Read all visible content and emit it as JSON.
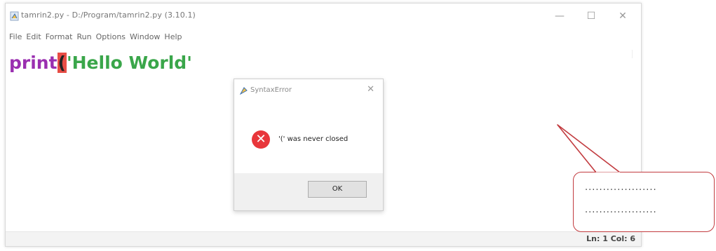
{
  "window": {
    "title": "tamrin2.py - D:/Program/tamrin2.py (3.10.1)",
    "minimize_glyph": "—",
    "maximize_glyph": "☐",
    "close_glyph": "✕"
  },
  "menu": [
    "File",
    "Edit",
    "Format",
    "Run",
    "Options",
    "Window",
    "Help"
  ],
  "editor": {
    "keyword": "print",
    "paren": "(",
    "string": "'Hello World'"
  },
  "status": "Ln: 1   Col: 6",
  "dialog": {
    "title": "SyntaxError",
    "close_glyph": "✕",
    "error_glyph": "✕",
    "message": "'(' was never closed",
    "ok_label": "OK"
  },
  "callout": {
    "line1": "....................",
    "line2": "...................."
  },
  "colors": {
    "keyword": "#9a2fb0",
    "string": "#3aa64a",
    "paren_highlight": "#e74c45",
    "error_icon": "#e8363b",
    "callout_border": "#c23b3f"
  }
}
